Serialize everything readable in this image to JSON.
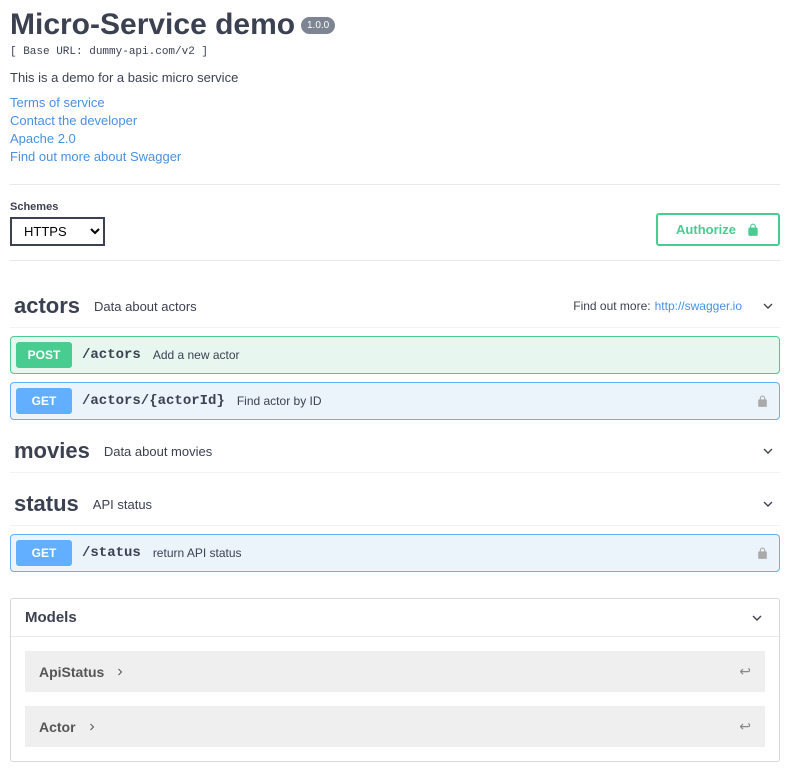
{
  "header": {
    "title": "Micro-Service demo",
    "version": "1.0.0",
    "baseUrlLine": "[ Base URL: dummy-api.com/v2 ]",
    "description": "This is a demo for a basic micro service"
  },
  "links": {
    "terms": "Terms of service",
    "contact": "Contact the developer",
    "license": "Apache 2.0",
    "external": "Find out more about Swagger"
  },
  "schemes": {
    "label": "Schemes",
    "selected": "HTTPS"
  },
  "authorize": {
    "label": "Authorize"
  },
  "tags": {
    "actors": {
      "name": "actors",
      "desc": "Data about actors",
      "findOutLabel": "Find out more:",
      "findOutLink": "http://swagger.io"
    },
    "movies": {
      "name": "movies",
      "desc": "Data about movies"
    },
    "status": {
      "name": "status",
      "desc": "API status"
    }
  },
  "ops": {
    "postActors": {
      "method": "POST",
      "path": "/actors",
      "summary": "Add a new actor"
    },
    "getActor": {
      "method": "GET",
      "path": "/actors/{actorId}",
      "summary": "Find actor by ID"
    },
    "getStatus": {
      "method": "GET",
      "path": "/status",
      "summary": "return API status"
    }
  },
  "models": {
    "title": "Models",
    "items": {
      "apiStatus": "ApiStatus",
      "actor": "Actor"
    }
  }
}
